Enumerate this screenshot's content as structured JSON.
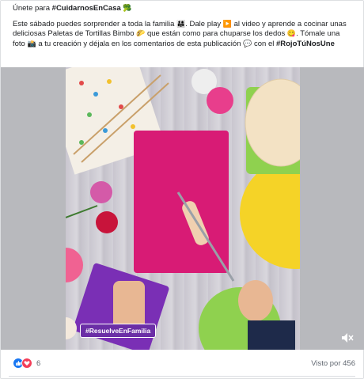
{
  "post": {
    "line1_prefix": "Únete para ",
    "line1_tag": "#CuidarnosEnCasa",
    "line1_emoji": "🥦",
    "body_a": "Este sábado puedes sorprender a toda la familia ",
    "emoji_family": "👨‍👩‍👧",
    "body_b": ". Dale play ",
    "emoji_play": "▶️",
    "body_c": " al video y aprende a cocinar unas deliciosas Paletas de Tortillas Bimbo ",
    "emoji_wrap": "🌮",
    "body_d": " que están como para chuparse los dedos ",
    "emoji_smile": "😋",
    "body_e": ". Tómale una foto ",
    "emoji_camera": "📸",
    "body_f": " a tu creación y déjala en los comentarios de esta publicación ",
    "emoji_speech": "💬",
    "body_g": " con el ",
    "tag2": "#RojoTúNosUne"
  },
  "video": {
    "overlay_hashtag": "#ResuelveEnFamilia",
    "mute_icon": "speaker-muted-icon"
  },
  "footer": {
    "reaction_count": "6",
    "seen_by": "Visto por 456"
  },
  "colors": {
    "board_pink": "#d81b75",
    "tortilla": "#f3e2c4",
    "yellow_plate": "#f5d327",
    "green_plate": "#8fd14f",
    "purple_napkin": "#7a2fb5",
    "like_blue": "#1877f2",
    "love_red": "#f33e58"
  }
}
